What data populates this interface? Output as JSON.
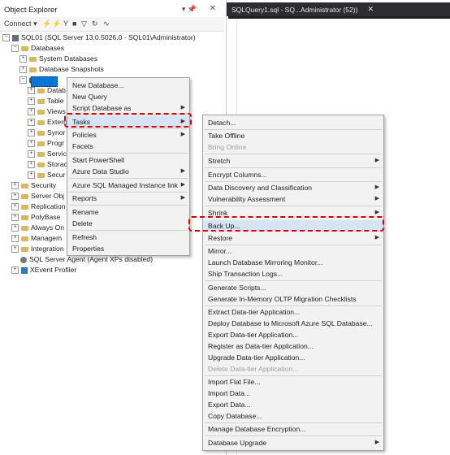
{
  "object_explorer": {
    "title": "Object Explorer",
    "pin_icon": "pin-icon",
    "close_icon": "close-icon",
    "toolbar": {
      "connect_label": "Connect ▾"
    },
    "tree": {
      "server": "SQL01 (SQL Server 13.0.5026.0 - SQL01\\Administrator)",
      "databases": "Databases",
      "system_databases": "System Databases",
      "database_snapshots": "Database Snapshots",
      "children": [
        "Datab",
        "Table",
        "Views",
        "Extern",
        "Synor",
        "Progr",
        "Servic",
        "Storac",
        "Secur"
      ],
      "security": "Security",
      "server_objects": "Server Obj",
      "replication": "Replication",
      "polybase": "PolyBase",
      "always_on": "Always On",
      "management": "Managem",
      "integration": "Integration",
      "agent": "SQL Server Agent (Agent XPs disabled)",
      "xevent": "XEvent Profiler"
    }
  },
  "document": {
    "tab_title": "SQLQuery1.sql - SQ...Administrator (52))",
    "tab_close": "✕"
  },
  "context_menu": {
    "items": [
      {
        "label": "New Database..."
      },
      {
        "label": "New Query"
      },
      {
        "label": "Script Database as",
        "submenu": true
      },
      {
        "label": "Tasks",
        "submenu": true
      },
      {
        "label": "Policies",
        "submenu": true
      },
      {
        "label": "Facets"
      },
      {
        "label": "Start PowerShell"
      },
      {
        "label": "Azure Data Studio",
        "submenu": true
      },
      {
        "label": "Azure SQL Managed Instance link",
        "submenu": true
      },
      {
        "label": "Reports",
        "submenu": true
      },
      {
        "label": "Rename"
      },
      {
        "label": "Delete"
      },
      {
        "label": "Refresh"
      },
      {
        "label": "Properties"
      }
    ]
  },
  "tasks_menu": {
    "items": [
      {
        "label": "Detach..."
      },
      {
        "label": "Take Offline"
      },
      {
        "label": "Bring Online",
        "disabled": true
      },
      {
        "label": "Stretch",
        "submenu": true
      },
      {
        "label": "Encrypt Columns..."
      },
      {
        "label": "Data Discovery and Classification",
        "submenu": true
      },
      {
        "label": "Vulnerability Assessment",
        "submenu": true
      },
      {
        "label": "Shrink",
        "submenu": true
      },
      {
        "label": "Back Up..."
      },
      {
        "label": "Restore",
        "submenu": true
      },
      {
        "label": "Mirror..."
      },
      {
        "label": "Launch Database Mirroring Monitor..."
      },
      {
        "label": "Ship Transaction Logs..."
      },
      {
        "label": "Generate Scripts..."
      },
      {
        "label": "Generate In-Memory OLTP Migration Checklists"
      },
      {
        "label": "Extract Data-tier Application..."
      },
      {
        "label": "Deploy Database to Microsoft Azure SQL Database..."
      },
      {
        "label": "Export Data-tier Application..."
      },
      {
        "label": "Register as Data-tier Application..."
      },
      {
        "label": "Upgrade Data-tier Application..."
      },
      {
        "label": "Delete Data-tier Application...",
        "disabled": true
      },
      {
        "label": "Import Flat File..."
      },
      {
        "label": "Import Data..."
      },
      {
        "label": "Export Data..."
      },
      {
        "label": "Copy Database..."
      },
      {
        "label": "Manage Database Encryption..."
      },
      {
        "label": "Database Upgrade",
        "submenu": true
      }
    ]
  },
  "colors": {
    "highlight_red": "#e00000",
    "selection_blue": "#0078d7",
    "tab_dark": "#2d2d30"
  }
}
